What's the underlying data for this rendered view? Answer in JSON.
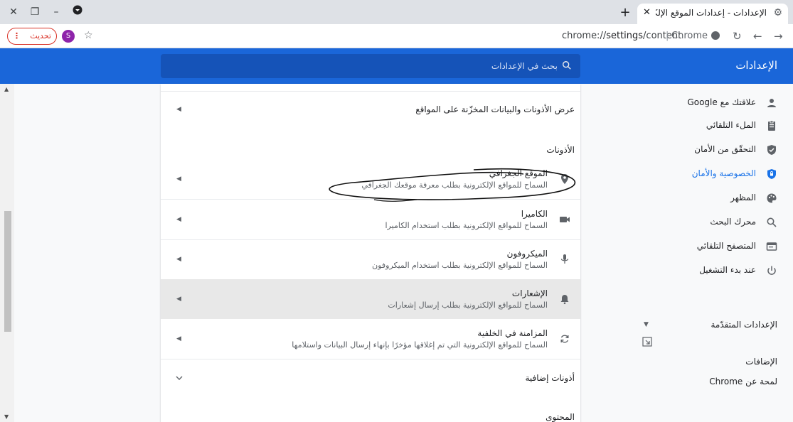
{
  "browser": {
    "tab_title": "الإعدادات - إعدادات الموقع الإلكتروني",
    "url_host": "chrome://",
    "url_bold": "settings",
    "url_path": "/content",
    "omnibox_label": "Chrome",
    "update_label": "تحديث",
    "avatar_letter": "S"
  },
  "header": {
    "title": "الإعدادات",
    "search_placeholder": "بحث في الإعدادات"
  },
  "sidebar": {
    "items": [
      {
        "label": "علاقتك مع Google",
        "icon": "person-icon"
      },
      {
        "label": "الملء التلقائي",
        "icon": "clipboard-icon"
      },
      {
        "label": "التحقّق من الأمان",
        "icon": "shield-check-icon"
      },
      {
        "label": "الخصوصية والأمان",
        "icon": "shield-lock-icon",
        "active": true
      },
      {
        "label": "المظهر",
        "icon": "palette-icon"
      },
      {
        "label": "محرك البحث",
        "icon": "search-icon"
      },
      {
        "label": "المتصفح التلقائي",
        "icon": "browser-icon"
      },
      {
        "label": "عند بدء التشغيل",
        "icon": "power-icon"
      }
    ],
    "advanced": "الإعدادات المتقدّمة",
    "extensions": "الإضافات",
    "about": "لمحة عن Chrome"
  },
  "content": {
    "view_data_row": "عرض الأذونات والبيانات المخزّنة على المواقع",
    "permissions_heading": "الأذونات",
    "permissions": [
      {
        "title": "الموقع الجغرافي",
        "sub": "السماح للمواقع الإلكترونية بطلب معرفة موقعك الجغرافي",
        "icon": "location-pin-icon"
      },
      {
        "title": "الكاميرا",
        "sub": "السماح للمواقع الإلكترونية بطلب استخدام الكاميرا",
        "icon": "camera-icon"
      },
      {
        "title": "الميكروفون",
        "sub": "السماح للمواقع الإلكترونية بطلب استخدام الميكروفون",
        "icon": "microphone-icon"
      },
      {
        "title": "الإشعارات",
        "sub": "السماح للمواقع الإلكترونية بطلب إرسال إشعارات",
        "icon": "bell-icon",
        "highlighted": true
      },
      {
        "title": "المزامنة في الخلفية",
        "sub": "السماح للمواقع الإلكترونية التي تم إغلاقها مؤخرًا بإنهاء إرسال البيانات واستلامها",
        "icon": "sync-icon"
      }
    ],
    "more_permissions": "أذونات إضافية",
    "content_heading": "المحتوى"
  },
  "colors": {
    "header_blue": "#1a66d9",
    "active_blue": "#1a73e8",
    "highlight_row": "#e8e8e8",
    "update_red": "#d93025"
  }
}
